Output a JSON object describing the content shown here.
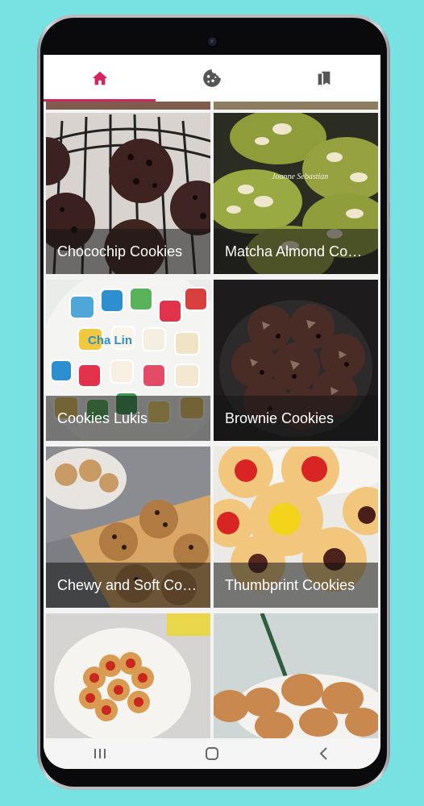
{
  "tabs": [
    {
      "icon": "home-icon",
      "active": true
    },
    {
      "icon": "cookie-icon",
      "active": false
    },
    {
      "icon": "bookmarks-icon",
      "active": false
    }
  ],
  "colors": {
    "accent": "#d2255f",
    "tab_icon": "#555555",
    "background": "#78e2e2"
  },
  "recipes": [
    {
      "title": "Chocochip Cookies"
    },
    {
      "title": "Matcha Almond Cookies"
    },
    {
      "title": "Cookies Lukis"
    },
    {
      "title": "Brownie Cookies"
    },
    {
      "title": "Chewy and Soft Cookies"
    },
    {
      "title": "Thumbprint Cookies"
    },
    {
      "title": ""
    },
    {
      "title": ""
    }
  ],
  "photo_overlay_text": {
    "matcha": "Joanne Sebastian",
    "letters": "Cha Lin"
  },
  "navbar": {
    "recents": "recents-icon",
    "home": "home-circle-icon",
    "back": "back-icon"
  }
}
